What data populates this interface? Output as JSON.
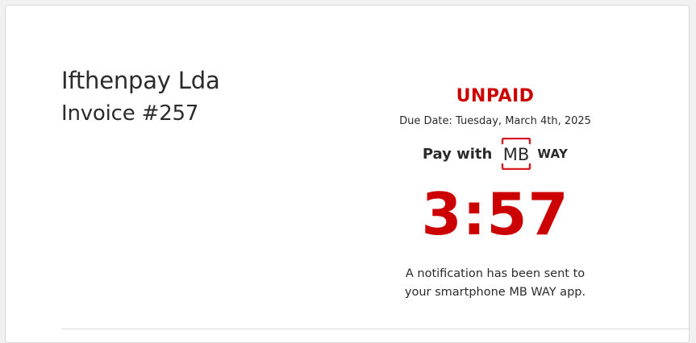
{
  "invoice": {
    "company": "Ifthenpay Lda",
    "number_label": "Invoice #257"
  },
  "payment": {
    "status": "UNPAID",
    "due_date": "Due Date: Tuesday, March 4th, 2025",
    "pay_with_label": "Pay with",
    "method_logo": {
      "mark": "MB",
      "word": "WAY",
      "icon": "mbway-logo-icon"
    },
    "countdown": "3:57",
    "notification_line1": "A notification has been sent to",
    "notification_line2": "your smartphone MB WAY app."
  },
  "colors": {
    "status_red": "#cc0000",
    "text": "#2b2b2b",
    "logo_red": "#d71920",
    "card_border": "#d9d9d9"
  }
}
